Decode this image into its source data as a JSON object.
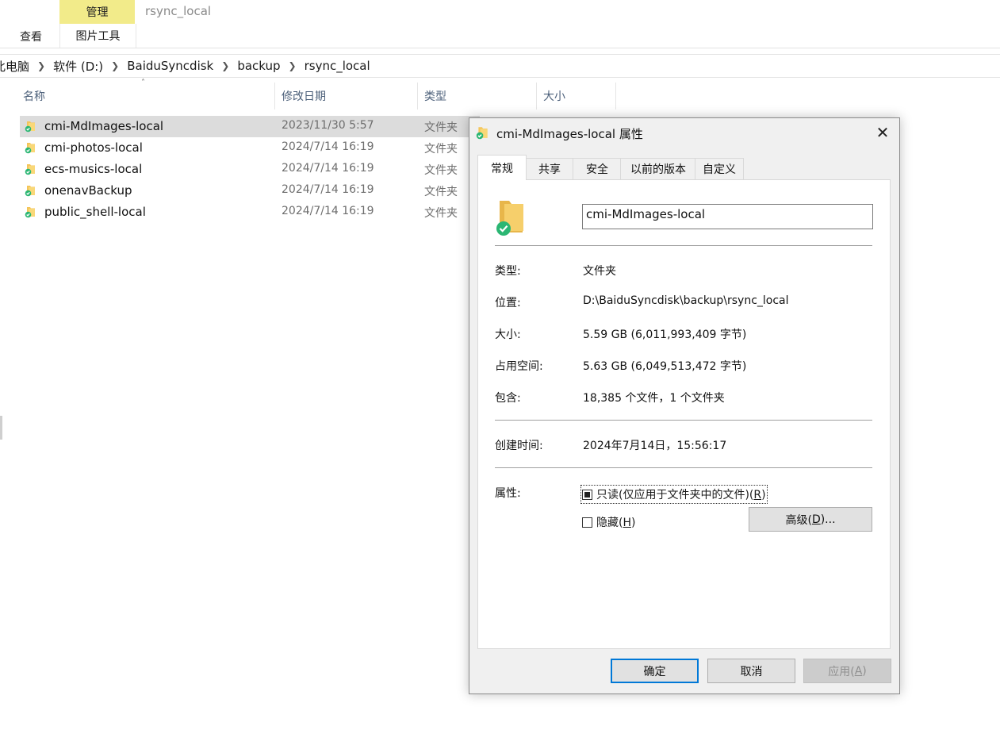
{
  "ribbon": {
    "manage_tab": "管理",
    "window_title": "rsync_local",
    "view_tab": "查看",
    "picture_tools_tab": "图片工具"
  },
  "breadcrumb": [
    "此电脑",
    "软件 (D:)",
    "BaiduSyncdisk",
    "backup",
    "rsync_local"
  ],
  "columns": {
    "name": "名称",
    "date": "修改日期",
    "type": "类型",
    "size": "大小"
  },
  "files": [
    {
      "name": "cmi-MdImages-local",
      "date": "2023/11/30 5:57",
      "type": "文件夹",
      "selected": true
    },
    {
      "name": "cmi-photos-local",
      "date": "2024/7/14 16:19",
      "type": "文件夹"
    },
    {
      "name": "ecs-musics-local",
      "date": "2024/7/14 16:19",
      "type": "文件夹"
    },
    {
      "name": "onenavBackup",
      "date": "2024/7/14 16:19",
      "type": "文件夹"
    },
    {
      "name": "public_shell-local",
      "date": "2024/7/14 16:19",
      "type": "文件夹"
    }
  ],
  "dialog": {
    "title": "cmi-MdImages-local 属性",
    "tabs": [
      "常规",
      "共享",
      "安全",
      "以前的版本",
      "自定义"
    ],
    "folder_name": "cmi-MdImages-local",
    "type_label": "类型:",
    "type_value": "文件夹",
    "location_label": "位置:",
    "location_value": "D:\\BaiduSyncdisk\\backup\\rsync_local",
    "size_label": "大小:",
    "size_value": "5.59 GB (6,011,993,409 字节)",
    "disk_label": "占用空间:",
    "disk_value": "5.63 GB (6,049,513,472 字节)",
    "contains_label": "包含:",
    "contains_value": "18,385 个文件，1 个文件夹",
    "created_label": "创建时间:",
    "created_value": "2024年7月14日，15:56:17",
    "attr_label": "属性:",
    "readonly_label": "只读(仅应用于文件夹中的文件)(",
    "readonly_key": "R",
    "readonly_end": ")",
    "hidden_label": "隐藏(",
    "hidden_key": "H",
    "hidden_end": ")",
    "advanced_label": "高级(",
    "advanced_key": "D",
    "advanced_end": ")...",
    "ok": "确定",
    "cancel": "取消",
    "apply_label": "应用(",
    "apply_key": "A",
    "apply_end": ")"
  },
  "colors": {
    "ribbon_manage": "#f2eb8a",
    "accent": "#0078d7",
    "selection": "#dcdcdc",
    "sync_badge": "#2bb673",
    "folder": "#f4c55a"
  }
}
